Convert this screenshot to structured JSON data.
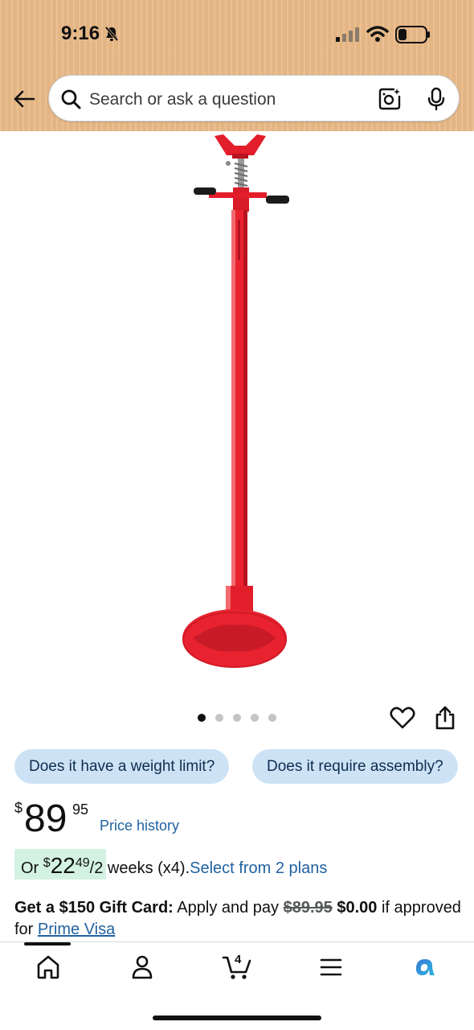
{
  "status_bar": {
    "time": "9:16"
  },
  "search": {
    "placeholder": "Search or ask a question"
  },
  "carousel": {
    "total": 5,
    "active_index": 0
  },
  "questions": [
    {
      "label": "Does it have a weight limit?"
    },
    {
      "label": "Does it require assembly?"
    }
  ],
  "price": {
    "symbol": "$",
    "whole": "89",
    "fraction": "95",
    "history_label": "Price history"
  },
  "installment": {
    "prefix": "Or ",
    "symbol": "$",
    "whole": "22",
    "fraction": "49",
    "period": "/2 weeks (x4).",
    "link_label": "Select from 2 plans"
  },
  "gift_card": {
    "headline": "Get a $150 Gift Card:",
    "text": " Apply and pay ",
    "original_price": "$89.95",
    "new_price": "$0.00",
    "suffix": " if approved for ",
    "link_label": "Prime Visa"
  },
  "bottom_nav": {
    "cart_count": "4",
    "items": [
      "home-icon",
      "account-icon",
      "cart-icon",
      "menu-icon",
      "rufus-icon"
    ]
  },
  "colors": {
    "header_bg": "#e9b987",
    "chip_bg": "#cde3f5",
    "link": "#2162a1",
    "badge_bg": "#d4f2e2",
    "product_red": "#e8232f"
  }
}
